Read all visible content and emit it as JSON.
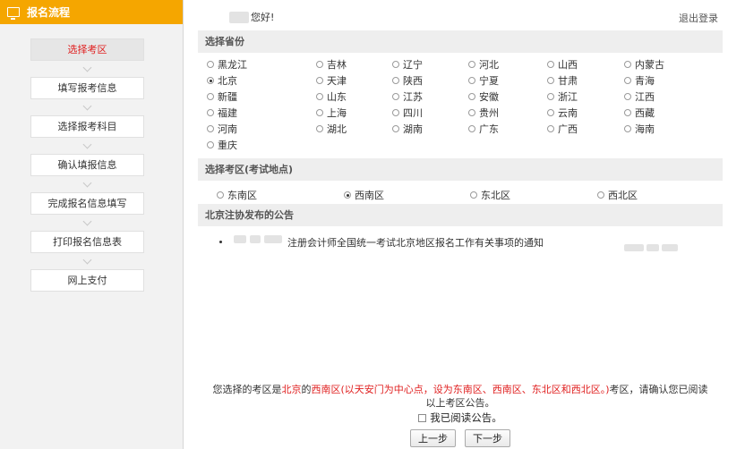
{
  "sidebar": {
    "title": "报名流程",
    "icon": "monitor-icon",
    "steps": [
      "选择考区",
      "填写报考信息",
      "选择报考科目",
      "确认填报信息",
      "完成报名信息填写",
      "打印报名信息表",
      "网上支付"
    ],
    "active_step": "选择考区",
    "colors": {
      "header_bg": "#f5a600",
      "active_text": "#e02020"
    }
  },
  "header": {
    "greeting": "您好!",
    "logout": "退出登录"
  },
  "province_section": {
    "title": "选择省份",
    "provinces": [
      "黑龙江",
      "吉林",
      "辽宁",
      "河北",
      "山西",
      "内蒙古",
      "北京",
      "天津",
      "陕西",
      "宁夏",
      "甘肃",
      "青海",
      "新疆",
      "山东",
      "江苏",
      "安徽",
      "浙江",
      "江西",
      "福建",
      "上海",
      "四川",
      "贵州",
      "云南",
      "西藏",
      "河南",
      "湖北",
      "湖南",
      "广东",
      "广西",
      "海南",
      "重庆"
    ],
    "selected": "北京"
  },
  "zone_section": {
    "title": "选择考区(考试地点)",
    "zones": [
      "东南区",
      "西南区",
      "东北区",
      "西北区"
    ],
    "selected": "西南区"
  },
  "notice_section": {
    "title": "北京注协发布的公告",
    "items": [
      {
        "title": "注册会计师全国统一考试北京地区报名工作有关事项的通知"
      }
    ]
  },
  "confirm": {
    "prefix": "您选择的考区是",
    "province": "北京",
    "of": "的",
    "zone_detail": "西南区(以天安门为中心点，设为东南区、西南区、东北区和西北区。)",
    "suffix": "考区，请确认您已阅读",
    "line2": "以上考区公告。",
    "checkbox_label": "我已阅读公告。",
    "prev_button": "上一步",
    "next_button": "下一步"
  }
}
